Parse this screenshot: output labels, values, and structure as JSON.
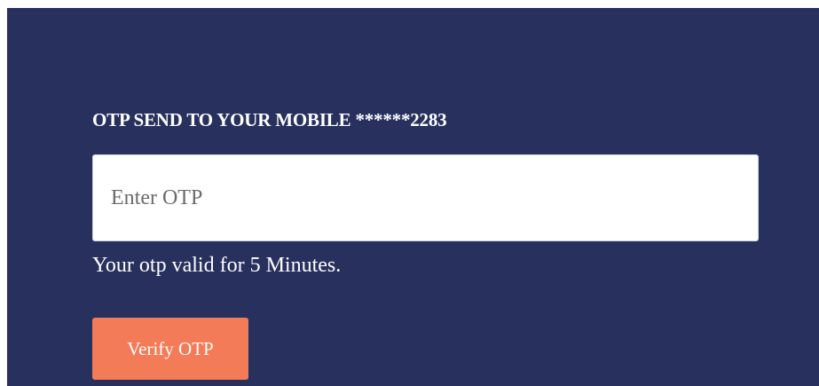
{
  "otp_form": {
    "heading": "OTP SEND TO YOUR MOBILE ******2283",
    "input_placeholder": "Enter OTP",
    "input_value": "",
    "validity_note": "Your otp valid for 5 Minutes.",
    "verify_label": "Verify OTP"
  },
  "colors": {
    "panel_background": "#28305e",
    "button_accent": "#f47b57",
    "text_on_dark": "#ffffff"
  }
}
